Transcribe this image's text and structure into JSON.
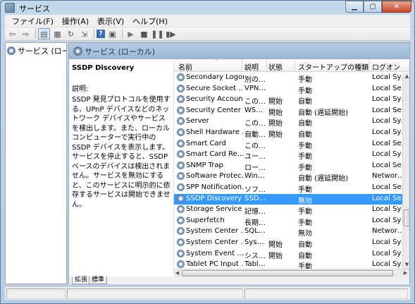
{
  "window": {
    "title": "サービス"
  },
  "menu": [
    "ファイル(F)",
    "操作(A)",
    "表示(V)",
    "ヘルプ(H)"
  ],
  "tree": {
    "root_label": "サービス (ローカル)"
  },
  "pane": {
    "header": "サービス (ローカル)"
  },
  "description": {
    "service_name": "SSDP Discovery",
    "label": "説明:",
    "text": "SSDP 発見プロトコルを使用する、UPnP デバイスなどのネットワーク デバイスやサービスを検出します。また、ローカル コンピューターで実行中の SSDP デバイスを表示します。サービスを停止すると、SSDP ベースのデバイスは検出されません。サービスを無効にすると、このサービスに明示的に依存するサービスは開始できません。"
  },
  "columns": {
    "name": "名前",
    "description": "説明",
    "status": "状態",
    "startup": "スタートアップの種類",
    "logon": "ログオン"
  },
  "rows": [
    {
      "name": "Secondary Logon",
      "desc": "別の…",
      "status": "",
      "startup": "手動",
      "logon": "Local Sy…"
    },
    {
      "name": "Secure Socket …",
      "desc": "VPN…",
      "status": "",
      "startup": "手動",
      "logon": "Local Se…"
    },
    {
      "name": "Security Accoun…",
      "desc": "この…",
      "status": "開始",
      "startup": "自動",
      "logon": "Local Sy…"
    },
    {
      "name": "Security Center",
      "desc": "WS…",
      "status": "開始",
      "startup": "自動 (遅延開始)",
      "logon": "Local Se…"
    },
    {
      "name": "Server",
      "desc": "この…",
      "status": "開始",
      "startup": "自動",
      "logon": "Local Sy…"
    },
    {
      "name": "Shell Hardware …",
      "desc": "自動…",
      "status": "開始",
      "startup": "自動",
      "logon": "Local Sy…"
    },
    {
      "name": "Smart Card",
      "desc": "この…",
      "status": "",
      "startup": "手動",
      "logon": "Local Se…"
    },
    {
      "name": "Smart Card Re…",
      "desc": "ユー…",
      "status": "",
      "startup": "手動",
      "logon": "Local Sy…"
    },
    {
      "name": "SNMP Trap",
      "desc": "ロー…",
      "status": "",
      "startup": "手動",
      "logon": "Local Se…"
    },
    {
      "name": "Software Protec…",
      "desc": "Win…",
      "status": "",
      "startup": "自動 (遅延開始)",
      "logon": "Networ…"
    },
    {
      "name": "SPP Notification…",
      "desc": "ソフ…",
      "status": "",
      "startup": "手動",
      "logon": "Local Se…"
    },
    {
      "name": "SSDP Discovery",
      "desc": "SSD…",
      "status": "",
      "startup": "無効",
      "logon": "Local Se…",
      "selected": true
    },
    {
      "name": "Storage Service",
      "desc": "記憶…",
      "status": "",
      "startup": "手動",
      "logon": "Local Sy…"
    },
    {
      "name": "Superfetch",
      "desc": "長期…",
      "status": "",
      "startup": "手動",
      "logon": "Local Sy…"
    },
    {
      "name": "System Center …",
      "desc": "SQL…",
      "status": "",
      "startup": "無効",
      "logon": "Networ…"
    },
    {
      "name": "System Center …",
      "desc": "Sys…",
      "status": "開始",
      "startup": "自動",
      "logon": "Local Sy…"
    },
    {
      "name": "System Event …",
      "desc": "シス…",
      "status": "開始",
      "startup": "自動",
      "logon": "Local Sy…"
    },
    {
      "name": "Tablet PC Input …",
      "desc": "Tabl…",
      "status": "",
      "startup": "手動",
      "logon": "Local Sy…"
    }
  ],
  "tabs": [
    "拡張",
    "標準"
  ],
  "icons": [
    "back-icon",
    "forward-icon",
    "console-tree-icon",
    "properties-icon",
    "refresh-icon",
    "export-icon",
    "help-icon",
    "view-icon",
    "play-icon",
    "stop-icon",
    "pause-icon",
    "restart-icon"
  ]
}
